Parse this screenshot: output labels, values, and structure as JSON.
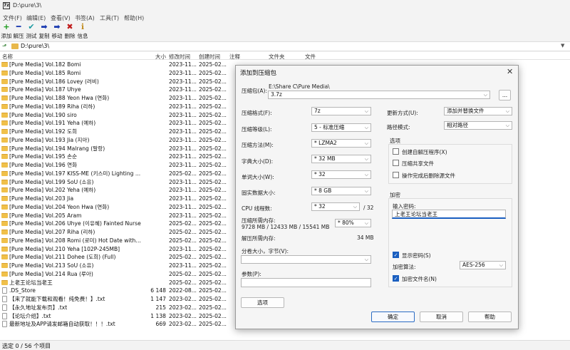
{
  "window": {
    "title": "D:\\pure\\3\\",
    "app_icon": "7z"
  },
  "menu": [
    "文件(F)",
    "编辑(E)",
    "查看(V)",
    "书签(A)",
    "工具(T)",
    "帮助(H)"
  ],
  "toolbar": [
    {
      "label": "添加",
      "icon": "+",
      "color": "#1a9a1a"
    },
    {
      "label": "解压",
      "icon": "━",
      "color": "#1a3ab0"
    },
    {
      "label": "测试",
      "icon": "✔",
      "color": "#1a9aa0"
    },
    {
      "label": "复制",
      "icon": "➡",
      "color": "#1a3ab0"
    },
    {
      "label": "移动",
      "icon": "➡",
      "color": "#1a3ab0"
    },
    {
      "label": "删除",
      "icon": "✖",
      "color": "#c01a1a"
    },
    {
      "label": "信息",
      "icon": "ℹ",
      "color": "#c08a1a"
    }
  ],
  "address": {
    "path": "D:\\pure\\3\\"
  },
  "columns": [
    "名称",
    "大小",
    "修改时间",
    "创建时间",
    "注释",
    "文件夹",
    "文件"
  ],
  "files": [
    {
      "type": "folder",
      "name": "[Pure Media] Vol.182 Bomi",
      "size": "",
      "modified": "2023-11...",
      "created": "2025-02..."
    },
    {
      "type": "folder",
      "name": "[Pure Media] Vol.185 Romi",
      "size": "",
      "modified": "2023-11...",
      "created": "2025-02..."
    },
    {
      "type": "folder",
      "name": "[Pure Media] Vol.186 Lovey (러비)",
      "size": "",
      "modified": "2023-11...",
      "created": "2025-02..."
    },
    {
      "type": "folder",
      "name": "[Pure Media] Vol.187 Uhye",
      "size": "",
      "modified": "2023-11...",
      "created": "2025-02..."
    },
    {
      "type": "folder",
      "name": "[Pure Media] Vol.188 Yeon Hwa (연화)",
      "size": "",
      "modified": "2023-11...",
      "created": "2025-02..."
    },
    {
      "type": "folder",
      "name": "[Pure Media] Vol.189 Riha (리하)",
      "size": "",
      "modified": "2023-11...",
      "created": "2025-02..."
    },
    {
      "type": "folder",
      "name": "[Pure Media] Vol.190 siro",
      "size": "",
      "modified": "2023-11...",
      "created": "2025-02..."
    },
    {
      "type": "folder",
      "name": "[Pure Media] Vol.191 Yeha (예하)",
      "size": "",
      "modified": "2023-11...",
      "created": "2025-02..."
    },
    {
      "type": "folder",
      "name": "[Pure Media] Vol.192 도희",
      "size": "",
      "modified": "2023-11...",
      "created": "2025-02..."
    },
    {
      "type": "folder",
      "name": "[Pure Media] Vol.193 Jia (지아)",
      "size": "",
      "modified": "2023-11...",
      "created": "2025-02..."
    },
    {
      "type": "folder",
      "name": "[Pure Media] Vol.194 Malrang (말랑)",
      "size": "",
      "modified": "2023-11...",
      "created": "2025-02..."
    },
    {
      "type": "folder",
      "name": "[Pure Media] Vol.195 손순",
      "size": "",
      "modified": "2023-11...",
      "created": "2025-02..."
    },
    {
      "type": "folder",
      "name": "[Pure Media] Vol.196 연화",
      "size": "",
      "modified": "2023-11...",
      "created": "2025-02..."
    },
    {
      "type": "folder",
      "name": "[Pure Media] Vol.197 KISS-ME (키스미) Lighting ...",
      "size": "",
      "modified": "2025-02...",
      "created": "2025-02..."
    },
    {
      "type": "folder",
      "name": "[Pure Media] Vol.199 SoU (소유)",
      "size": "",
      "modified": "2023-11...",
      "created": "2025-02..."
    },
    {
      "type": "folder",
      "name": "[Pure Media] Vol.202 Yeha (예하)",
      "size": "",
      "modified": "2023-11...",
      "created": "2025-02..."
    },
    {
      "type": "folder",
      "name": "[Pure Media] Vol.203 Jia",
      "size": "",
      "modified": "2023-11...",
      "created": "2025-02..."
    },
    {
      "type": "folder",
      "name": "[Pure Media] Vol.204 Yeon Hwa (연화)",
      "size": "",
      "modified": "2023-11...",
      "created": "2025-02..."
    },
    {
      "type": "folder",
      "name": "[Pure Media] Vol.205 Aram",
      "size": "",
      "modified": "2023-11...",
      "created": "2025-02..."
    },
    {
      "type": "folder",
      "name": "[Pure Media] Vol.206 Uhye (이유혜) Fainted Nurse",
      "size": "",
      "modified": "2025-02...",
      "created": "2025-02..."
    },
    {
      "type": "folder",
      "name": "[Pure Media] Vol.207 Riha (리하)",
      "size": "",
      "modified": "2025-02...",
      "created": "2025-02..."
    },
    {
      "type": "folder",
      "name": "[Pure Media] Vol.208 Romi (로미) Hot Date with ...",
      "size": "",
      "modified": "2025-02...",
      "created": "2025-02..."
    },
    {
      "type": "folder",
      "name": "[Pure Media] Vol.210 Yeha [102P-245MB]",
      "size": "",
      "modified": "2023-11...",
      "created": "2025-02..."
    },
    {
      "type": "folder",
      "name": "[Pure Media] Vol.211 Dohee (도희) (Full)",
      "size": "",
      "modified": "2025-02...",
      "created": "2025-02..."
    },
    {
      "type": "folder",
      "name": "[Pure Media] Vol.213 SoU (소유)",
      "size": "",
      "modified": "2023-11...",
      "created": "2025-02..."
    },
    {
      "type": "folder",
      "name": "[Pure Media] Vol.214 Rua (루아)",
      "size": "",
      "modified": "2025-02...",
      "created": "2025-02..."
    },
    {
      "type": "folder",
      "name": "上老王论坛当老王",
      "size": "",
      "modified": "2025-02...",
      "created": "2025-02..."
    },
    {
      "type": "file",
      "name": ".DS_Store",
      "size": "6 148",
      "modified": "2022-08...",
      "created": "2025-02..."
    },
    {
      "type": "file",
      "name": "【来了就能下载和观看！纯免费！】.txt",
      "size": "1 147",
      "modified": "2023-02...",
      "created": "2025-02..."
    },
    {
      "type": "file",
      "name": "【永久地址发布页】.txt",
      "size": "215",
      "modified": "2023-02...",
      "created": "2025-02..."
    },
    {
      "type": "file",
      "name": "【论坛介绍】.txt",
      "size": "1 138",
      "modified": "2023-02...",
      "created": "2025-02..."
    },
    {
      "type": "file",
      "name": "最新地址及APP请发邮箱自动获取！！！.txt",
      "size": "669",
      "modified": "2023-02...",
      "created": "2025-02..."
    }
  ],
  "status": "选定 0 / 56 个项目",
  "dialog": {
    "title": "添加到压缩包",
    "archive_label": "压缩包(A):",
    "archive_dir": "E:\\Share C\\Pure Media\\",
    "archive_name": "3.7z",
    "browse": "...",
    "format_label": "压缩格式(F):",
    "format": "7z",
    "level_label": "压缩等级(L):",
    "level": "5 - 标准压缩",
    "method_label": "压缩方法(M):",
    "method": "* LZMA2",
    "dict_label": "字典大小(D):",
    "dict": "* 32 MB",
    "word_label": "单词大小(W):",
    "word": "* 32",
    "solid_label": "固实数据大小:",
    "solid": "* 8 GB",
    "threads_label": "CPU 线程数:",
    "threads": "* 32",
    "threads_max": "/ 32",
    "mem_label": "压缩所需内存:",
    "mem_value": "9728 MB / 12433 MB / 15541 MB",
    "mem_pct": "* 80%",
    "demem_label": "解压所需内存:",
    "demem_value": "34 MB",
    "split_label": "分卷大小，字节(V):",
    "params_label": "参数(P):",
    "options_btn": "选项",
    "update_label": "更新方式(U):",
    "update": "添加并替换文件",
    "pathmode_label": "路径模式:",
    "pathmode": "相对路径",
    "opts_group": "选项",
    "opt_sfx": "创建自解压程序(X)",
    "opt_shared": "压缩共享文件",
    "opt_delete": "操作完成后删除源文件",
    "enc_group": "加密",
    "pwd_label": "输入密码:",
    "pwd_value": "上老王论坛当老王",
    "show_pwd": "显示密码(S)",
    "enc_method_label": "加密算法:",
    "enc_method": "AES-256",
    "enc_names": "加密文件名(N)",
    "ok": "确定",
    "cancel": "取消",
    "help": "帮助"
  }
}
